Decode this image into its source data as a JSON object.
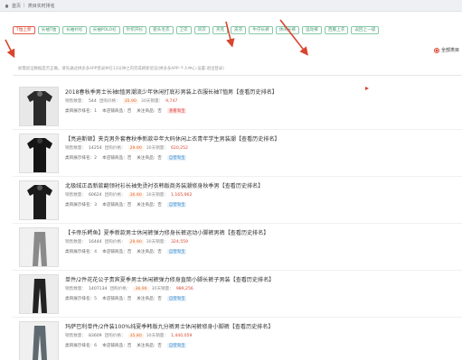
{
  "breadcrumb": {
    "home": "首页",
    "current": "类目实时排名"
  },
  "tabs": [
    {
      "label": "T恤上新",
      "active": true
    },
    {
      "label": "长袖T恤",
      "active": false
    },
    {
      "label": "长袖衬衫",
      "active": false
    },
    {
      "label": "长袖POLO衫",
      "active": false
    },
    {
      "label": "针织开衫",
      "active": false
    },
    {
      "label": "套头毛衣",
      "active": false
    },
    {
      "label": "卫衣",
      "active": false
    },
    {
      "label": "风衣",
      "active": false
    },
    {
      "label": "夹克",
      "active": false
    },
    {
      "label": "皮衣",
      "active": false
    },
    {
      "label": "牛仔长裤",
      "active": false
    },
    {
      "label": "休闲长裤",
      "active": false
    },
    {
      "label": "运动裤",
      "active": false
    },
    {
      "label": "西服上衣",
      "active": false
    },
    {
      "label": "返回上一级",
      "active": false
    }
  ],
  "right_option": "全部类目",
  "notice": "如需验证数据是否正确，请先通过拼多多APP登录并在12分钟之内完成刷新验证(拼多多APP-个人中心-设置-退出登录)",
  "labels": {
    "sales": "销售数量：",
    "price": "团购价格：",
    "sales30": "30天销量：",
    "rank": "类目展示排名：",
    "store": "本店铺商品：",
    "follow": "关注商品："
  },
  "products": [
    {
      "title": "2018春秋季男士长袖t恤男潮流少年休闲打底衫男装上衣服长袖T恤男【查看历史排名】",
      "sales": "544",
      "price": "35.90",
      "sales30": "9,747",
      "rank": "1",
      "store": "否",
      "follow": "否",
      "badge": "查看淘宝",
      "badge_color": "red"
    },
    {
      "title": "【亮迪斯顿】夹克男外套春秋季新款中年大码休闲上衣青年学生男装潮【查看历史排名】",
      "sales": "14254",
      "price": "29.90",
      "sales30": "620,252",
      "rank": "2",
      "store": "否",
      "follow": "否",
      "badge": "自营淘宝",
      "badge_color": "blue"
    },
    {
      "title": "北极绒正品新款翻领衬衫长袖免烫衬衣韩版商务装潮修身秋季男【查看历史排名】",
      "sales": "60624",
      "price": "36.90",
      "sales30": "1,165,962",
      "rank": "3",
      "store": "否",
      "follow": "否",
      "badge": "自营淘宝",
      "badge_color": "blue"
    },
    {
      "title": "【卡帝乐鳄鱼】夏季新款男士休闲裤弹力修身长裤运动小脚裤男裤【查看历史排名】",
      "sales": "16444",
      "price": "29.90",
      "sales30": "324,559",
      "rank": "4",
      "store": "否",
      "follow": "否",
      "badge": "自营淘宝",
      "badge_color": "blue"
    },
    {
      "title": "单件/2件花花公子贵宾夏季男士休闲裤弹力修身直筒小脚长裤子男装【查看历史排名】",
      "sales": "1407134",
      "price": "36.90",
      "sales30": "989,256",
      "rank": "5",
      "store": "否",
      "follow": "否",
      "badge": "自营淘宝",
      "badge_color": "blue"
    },
    {
      "title": "玛萨巴利单件/2件装100%纯夏季韩版九分裤男士休闲裤修身小脚裤【查看历史排名】",
      "sales": "83609",
      "price": "35.80",
      "sales30": "1,440,059",
      "rank": "6",
      "store": "否",
      "follow": "否",
      "badge": "自营淘宝",
      "badge_color": "blue"
    }
  ],
  "colors": {
    "accent": "#d9452f",
    "tab_border": "#86c8a8",
    "tab_text": "#4a9a74"
  }
}
